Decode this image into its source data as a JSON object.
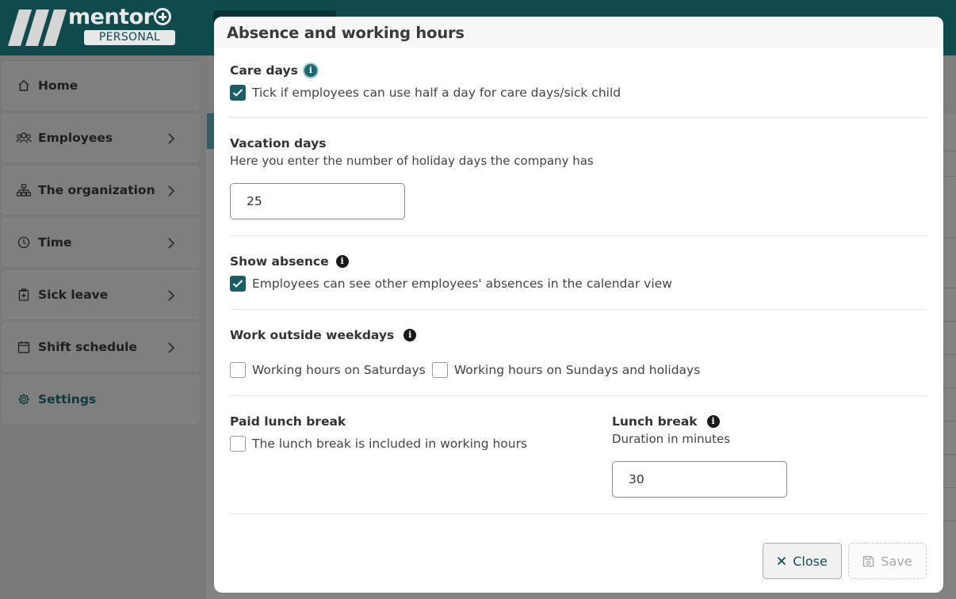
{
  "app": {
    "logo_word": "mentor",
    "logo_sub": "PERSONAL"
  },
  "sidebar": {
    "items": [
      {
        "label": "Home",
        "icon": "home-icon"
      },
      {
        "label": "Employees",
        "icon": "users-icon"
      },
      {
        "label": "The organization",
        "icon": "org-chart-icon"
      },
      {
        "label": "Time",
        "icon": "clock-icon"
      },
      {
        "label": "Sick leave",
        "icon": "medical-icon"
      },
      {
        "label": "Shift schedule",
        "icon": "calendar-icon"
      },
      {
        "label": "Settings",
        "icon": "gear-icon"
      }
    ]
  },
  "modal": {
    "title": "Absence and working hours",
    "care_days": {
      "heading": "Care days",
      "checkbox_label": "Tick if employees can use half a day for care days/sick child",
      "checked": true
    },
    "vacation_days": {
      "heading": "Vacation days",
      "description": "Here you enter the number of holiday days the company has",
      "value": "25"
    },
    "show_absence": {
      "heading": "Show absence",
      "checkbox_label": "Employees can see other employees' absences in the calendar view",
      "checked": true
    },
    "work_outside_weekdays": {
      "heading": "Work outside weekdays",
      "saturdays_label": "Working hours on Saturdays",
      "saturdays_checked": false,
      "sundays_label": "Working hours on Sundays and holidays",
      "sundays_checked": false
    },
    "paid_lunch_break": {
      "heading": "Paid lunch break",
      "checkbox_label": "The lunch break is included in working hours",
      "checked": false
    },
    "lunch_break": {
      "heading": "Lunch break",
      "description": "Duration in minutes",
      "value": "30"
    },
    "close_label": "Close",
    "save_label": "Save"
  },
  "colors": {
    "brand": "#0f4a4c",
    "checkbox_checked": "#1a5e63",
    "overlay": "#7c7c7c"
  }
}
